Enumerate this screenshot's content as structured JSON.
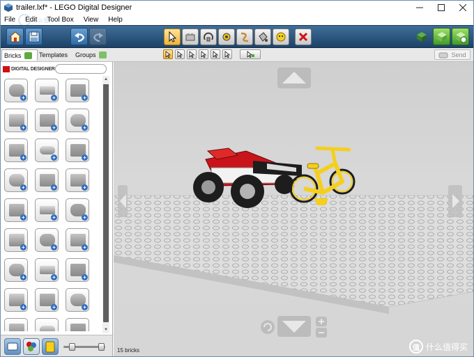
{
  "window": {
    "title": "trailer.lxf* - LEGO Digital Designer",
    "controls": [
      "minimize",
      "maximize",
      "close"
    ]
  },
  "menu": {
    "items": [
      "File",
      "Edit",
      "Tool Box",
      "View",
      "Help"
    ]
  },
  "overlay_watermark": "什么值得买",
  "toolbar": {
    "buttons": [
      {
        "name": "home",
        "icon": "home-icon"
      },
      {
        "name": "save",
        "icon": "save-icon"
      },
      {
        "name": "undo",
        "icon": "undo-icon"
      },
      {
        "name": "redo",
        "icon": "redo-icon"
      },
      {
        "name": "select",
        "icon": "cursor-icon"
      },
      {
        "name": "clone",
        "icon": "clone-icon"
      },
      {
        "name": "hinge",
        "icon": "hinge-icon"
      },
      {
        "name": "hinge-align",
        "icon": "hinge-align-icon"
      },
      {
        "name": "flex",
        "icon": "flex-icon"
      },
      {
        "name": "paint",
        "icon": "paint-bucket-icon"
      },
      {
        "name": "hide",
        "icon": "hide-icon"
      },
      {
        "name": "delete",
        "icon": "delete-icon"
      }
    ],
    "mode_buttons": [
      "build-mode",
      "view-mode",
      "building-guide-mode"
    ]
  },
  "palette": {
    "tabs": [
      "Bricks",
      "Templates",
      "Groups"
    ],
    "brand": "DIGITAL DESIGNER",
    "search_placeholder": "",
    "add_symbol": "+",
    "columns": 3,
    "rows": 9
  },
  "subbar": {
    "send_label": "Send"
  },
  "status": {
    "bricks": "15 bricks"
  },
  "corner_watermark": {
    "badge": "值",
    "text": "什么值得买"
  },
  "colors": {
    "toolbar_top": "#3f6e98",
    "toolbar_bottom": "#1d4268",
    "active_tool": "#f0b43c",
    "lego_red": "#c8141a",
    "bike_yellow": "#f5cf1e",
    "tire": "#1d1d1d"
  }
}
